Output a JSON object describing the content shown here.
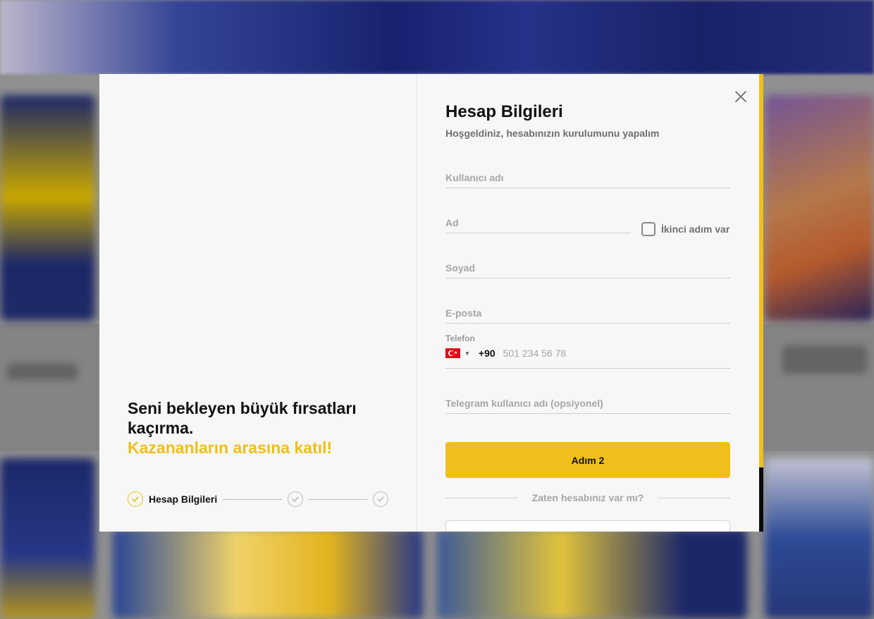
{
  "colors": {
    "accent": "#f1bf1c",
    "panel": "#f7f7f7",
    "text": "#111111",
    "muted": "#a6a6a6"
  },
  "promo": {
    "line1": "Seni bekleyen büyük fırsatları kaçırma.",
    "line2": "Kazananların arasına katıl!"
  },
  "steps": [
    {
      "label": "Hesap Bilgileri",
      "icon": "check-icon",
      "active": true
    },
    {
      "label": "",
      "icon": "check-icon",
      "active": false
    },
    {
      "label": "",
      "icon": "check-icon",
      "active": false
    }
  ],
  "form": {
    "title": "Hesap Bilgileri",
    "subtitle": "Hoşgeldiniz, hesabınızın kurulumunu yapalım",
    "username_placeholder": "Kullanıcı adı",
    "name_placeholder": "Ad",
    "second_name_checkbox": "İkinci adım var",
    "surname_placeholder": "Soyad",
    "email_placeholder": "E-posta",
    "phone": {
      "label": "Telefon",
      "country_code": "+90",
      "placeholder": "501 234 56 78",
      "flag": "turkey-flag-icon"
    },
    "telegram_placeholder": "Telegram kullanıcı adı (opsiyonel)",
    "submit_label": "Adım 2",
    "login_prompt": "Zaten hesabınız var mı?"
  }
}
